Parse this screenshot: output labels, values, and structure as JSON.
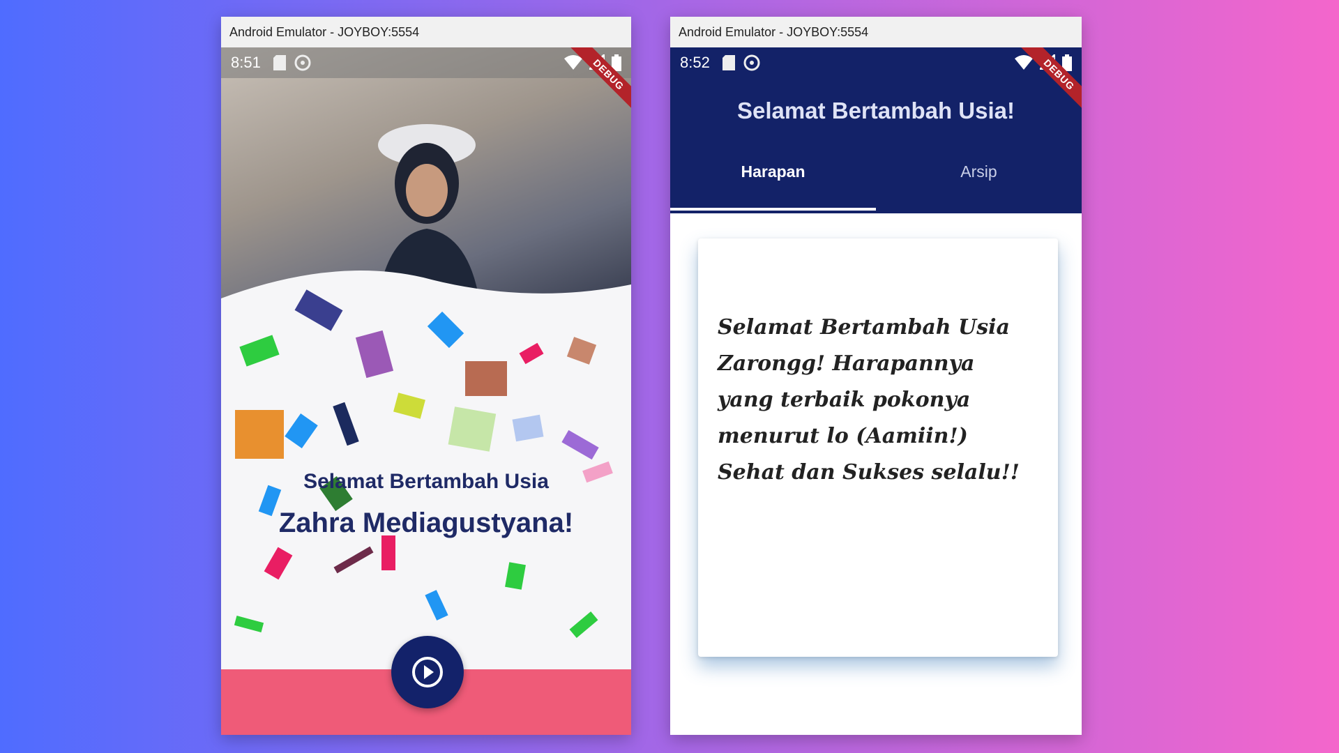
{
  "left_window": {
    "title": "Android Emulator - JOYBOY:5554",
    "status": {
      "time": "8:51"
    },
    "debug_label": "DEBUG",
    "greeting": {
      "line1": "Selamat Bertambah Usia",
      "line2": "Zahra Mediagustyana!"
    },
    "play_icon": "play-circle-icon"
  },
  "right_window": {
    "title": "Android Emulator - JOYBOY:5554",
    "status": {
      "time": "8:52"
    },
    "debug_label": "DEBUG",
    "appbar_title": "Selamat Bertambah Usia!",
    "tabs": [
      {
        "label": "Harapan",
        "active": true
      },
      {
        "label": "Arsip",
        "active": false
      }
    ],
    "card_message": "Selamat Bertambah Usia Zarongg! Harapannya yang terbaik pokonya menurut lo (Aamiin!) Sehat dan Sukses selalu!!"
  },
  "colors": {
    "appbar": "#132268",
    "play_button": "#13226a",
    "bottom_band": "#ef5b78",
    "debug_ribbon": "#b3232a"
  }
}
